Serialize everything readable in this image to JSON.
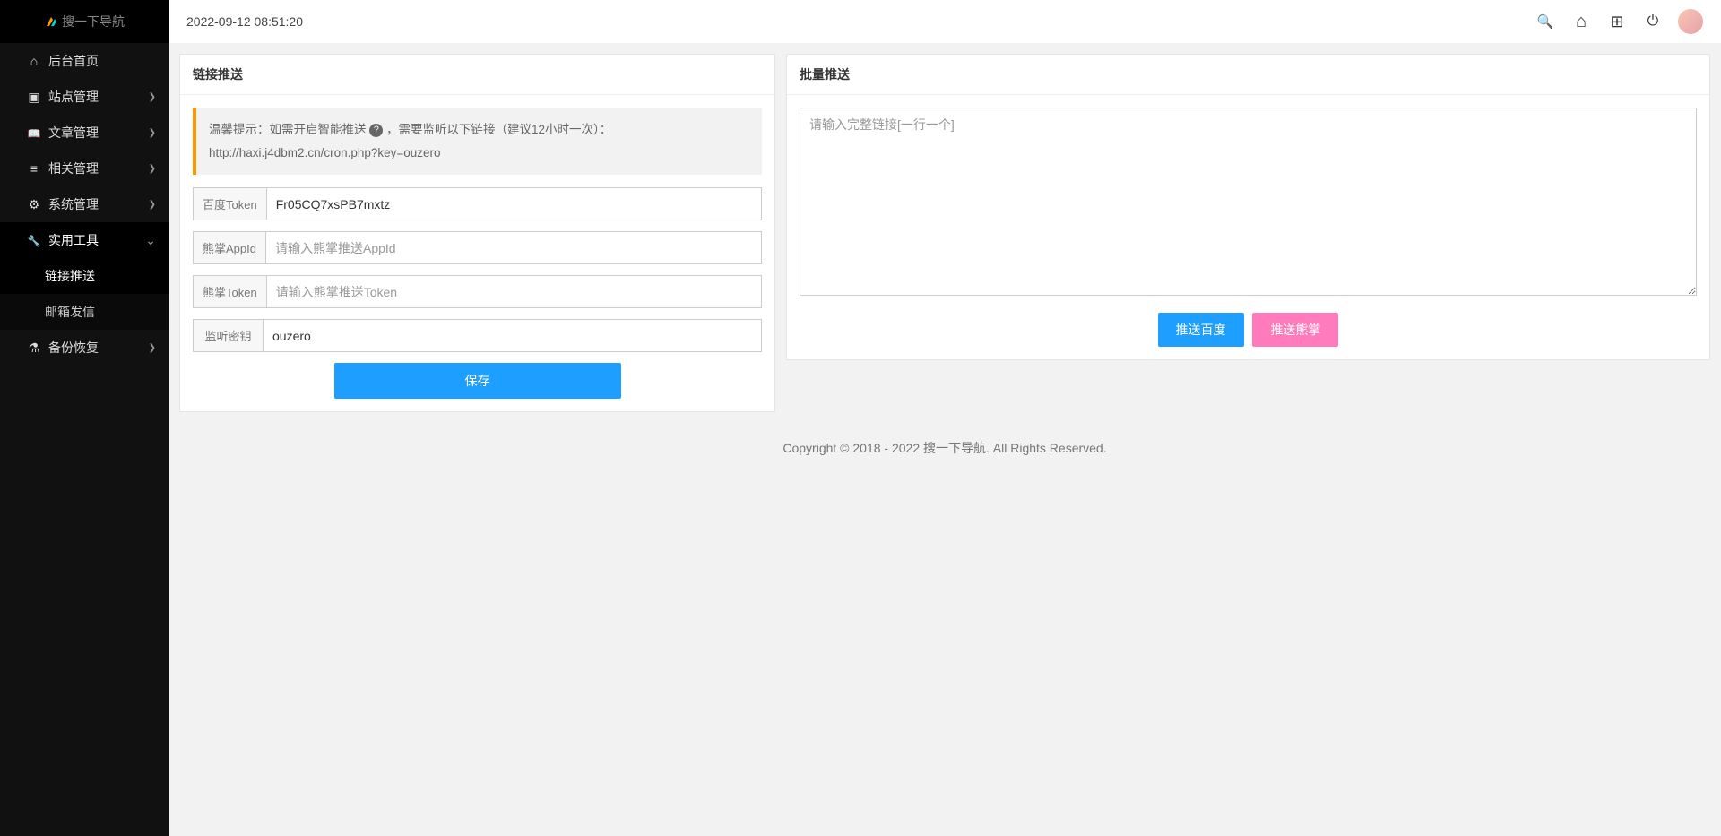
{
  "brand": {
    "name": "搜一下导航"
  },
  "timestamp": "2022-09-12 08:51:20",
  "sidebar": {
    "items": [
      {
        "icon": "home",
        "label": "后台首页",
        "chev": false
      },
      {
        "icon": "cube",
        "label": "站点管理",
        "chev": true
      },
      {
        "icon": "book",
        "label": "文章管理",
        "chev": true
      },
      {
        "icon": "sliders",
        "label": "相关管理",
        "chev": true
      },
      {
        "icon": "cog",
        "label": "系统管理",
        "chev": true
      },
      {
        "icon": "wrench",
        "label": "实用工具",
        "chev": true,
        "open": true,
        "children": [
          {
            "label": "链接推送",
            "active": true
          },
          {
            "label": "邮箱发信"
          }
        ]
      },
      {
        "icon": "flask",
        "label": "备份恢复",
        "chev": true
      }
    ]
  },
  "panel_left": {
    "title": "链接推送",
    "alert": {
      "prefix": "温馨提示：如需开启智能推送 ",
      "mid": " ，需要监听以下链接（建议12小时一次）：",
      "url": "http://haxi.j4dbm2.cn/cron.php?key=ouzero"
    },
    "fields": {
      "baidu_token": {
        "label": "百度Token",
        "value": "Fr05CQ7xsPB7mxtz"
      },
      "xz_appid": {
        "label": "熊掌AppId",
        "placeholder": "请输入熊掌推送AppId",
        "value": ""
      },
      "xz_token": {
        "label": "熊掌Token",
        "placeholder": "请输入熊掌推送Token",
        "value": ""
      },
      "listen_key": {
        "label": "监听密钥",
        "value": "ouzero"
      }
    },
    "save_label": "保存"
  },
  "panel_right": {
    "title": "批量推送",
    "placeholder": "请输入完整链接[一行一个]",
    "btn_baidu": "推送百度",
    "btn_xz": "推送熊掌"
  },
  "footer": "Copyright © 2018 - 2022 搜一下导航. All Rights Reserved.",
  "statusbar": "javascript:;"
}
